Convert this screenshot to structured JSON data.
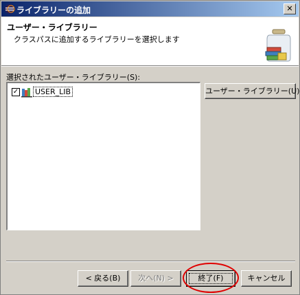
{
  "window": {
    "title": "ライブラリーの追加",
    "close_glyph": "✕"
  },
  "header": {
    "title": "ユーザー・ライブラリー",
    "description": "クラスパスに追加するライブラリーを選択します",
    "icon": "library-jar-icon"
  },
  "list": {
    "label": "選択されたユーザー・ライブラリー(S):",
    "items": [
      {
        "name": "USER_LIB",
        "checked": true,
        "check_glyph": "✓"
      }
    ]
  },
  "buttons": {
    "user_libraries": "ユーザー・ライブラリー(U)...",
    "back": "< 戻る(B)",
    "next": "次へ(N) >",
    "finish": "終了(F)",
    "cancel": "キャンセル"
  },
  "colors": {
    "title_gradient_start": "#0a246a",
    "title_gradient_end": "#a6caf0",
    "highlight": "#e00000",
    "dialog_bg": "#d4d0c8"
  }
}
